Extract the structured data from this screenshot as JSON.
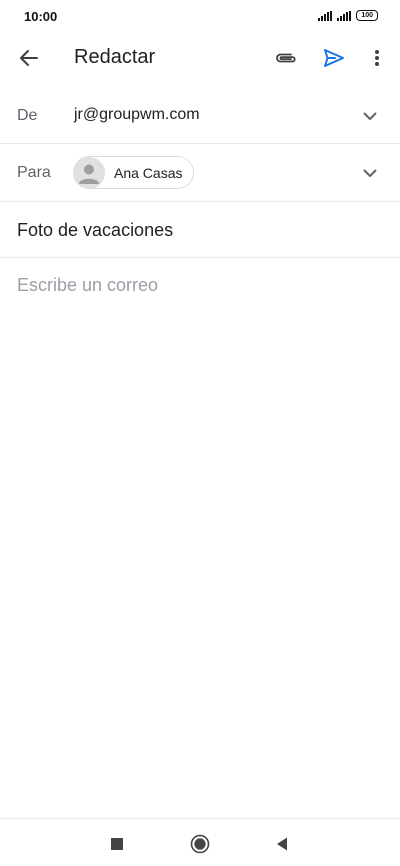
{
  "status_bar": {
    "time": "10:00",
    "battery": "100",
    "icons": [
      "signal-icon",
      "signal-icon",
      "battery-icon"
    ]
  },
  "app_bar": {
    "title": "Redactar",
    "icons": [
      "back-arrow-icon",
      "paperclip-icon",
      "send-icon",
      "more-vert-icon"
    ],
    "accent_color": "#1a73e8"
  },
  "compose": {
    "from_label": "De",
    "from_value": "jr@groupwm.com",
    "to_label": "Para",
    "recipients": [
      {
        "name": "Ana Casas",
        "avatar_icon": "person-icon"
      }
    ],
    "subject": "Foto de vacaciones",
    "body_placeholder": "Escribe un correo"
  },
  "nav_bar": {
    "icons": [
      "square-recents-icon",
      "circle-home-icon",
      "triangle-back-icon"
    ]
  }
}
